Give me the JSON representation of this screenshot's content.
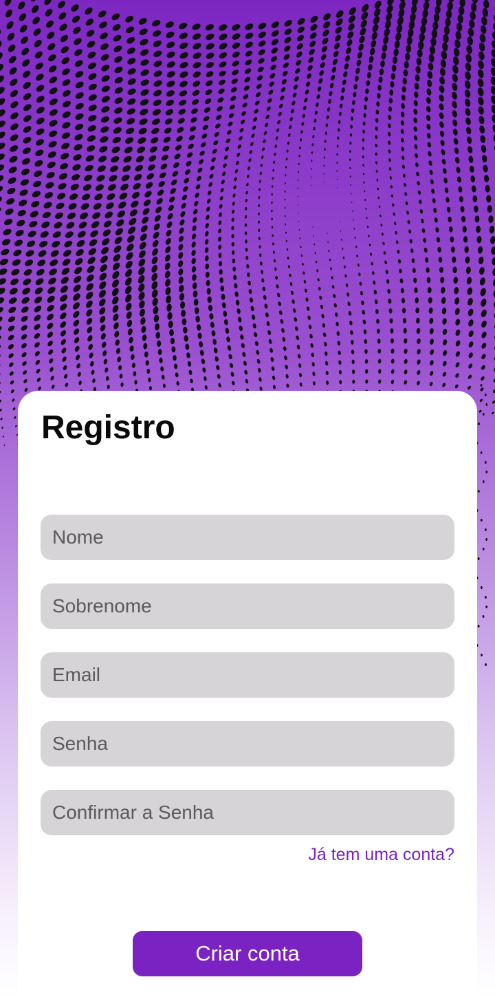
{
  "register": {
    "title": "Registro",
    "fields": {
      "first_name_placeholder": "Nome",
      "last_name_placeholder": "Sobrenome",
      "email_placeholder": "Email",
      "password_placeholder": "Senha",
      "confirm_password_placeholder": "Confirmar a Senha"
    },
    "login_link": "Já tem uma conta?",
    "submit_label": "Criar conta"
  },
  "colors": {
    "accent": "#7b23c2",
    "background_top": "#7d27c2",
    "field_background": "#d6d4d6"
  }
}
